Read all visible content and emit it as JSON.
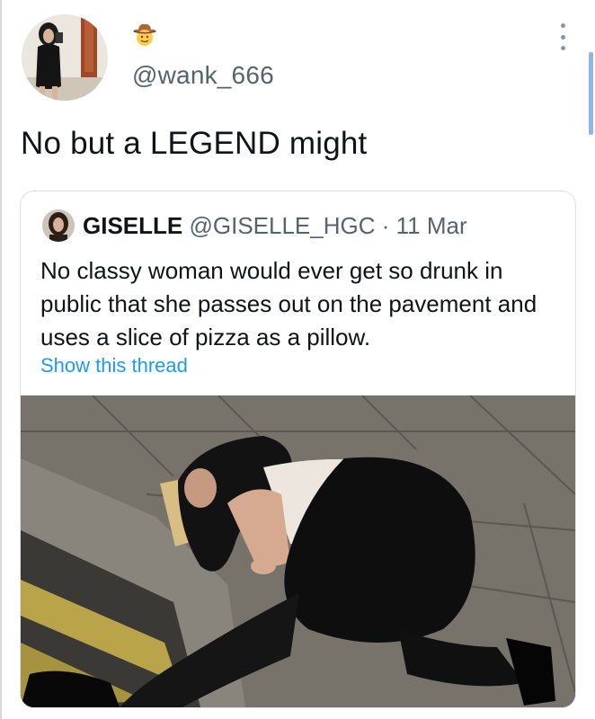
{
  "tweet": {
    "handle": "@wank_666",
    "text": "No but a LEGEND might",
    "emoji": "cowboy-hat-face-icon"
  },
  "quoted_tweet": {
    "name": "GISELLE",
    "handle": "@GISELLE_HGC",
    "separator": "·",
    "date": "11 Mar",
    "text": "No classy woman would ever get so drunk in public that she passes out on the pavement and uses a slice of pizza as a pillow.",
    "thread_link": "Show this thread"
  },
  "colors": {
    "text_primary": "#0f1419",
    "text_secondary": "#536471",
    "link": "#1d9bf0",
    "border": "#dbe1e6"
  }
}
